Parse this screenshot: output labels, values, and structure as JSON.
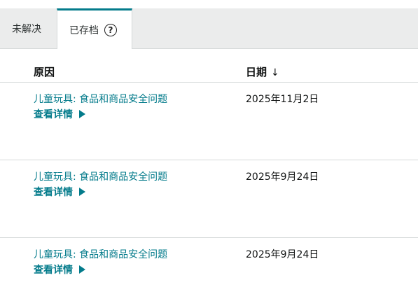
{
  "tabs": [
    {
      "label": "未解决",
      "active": false
    },
    {
      "label": "已存档",
      "active": true,
      "help_icon": "question-circle-icon"
    }
  ],
  "table": {
    "headers": {
      "reason": "原因",
      "date": "日期",
      "sort_icon": "arrow-down-icon"
    },
    "rows": [
      {
        "reason": "儿童玩具: 食品和商品安全问题",
        "details_label": "查看详情",
        "date": "2025年11月2日"
      },
      {
        "reason": "儿童玩具: 食品和商品安全问题",
        "details_label": "查看详情",
        "date": "2025年9月24日"
      },
      {
        "reason": "儿童玩具: 食品和商品安全问题",
        "details_label": "查看详情",
        "date": "2025年9月24日"
      }
    ]
  },
  "colors": {
    "accent": "#037b8b",
    "tab_bar_bg": "#ebecec",
    "border": "#d5d9d9",
    "text": "#0f1111"
  }
}
